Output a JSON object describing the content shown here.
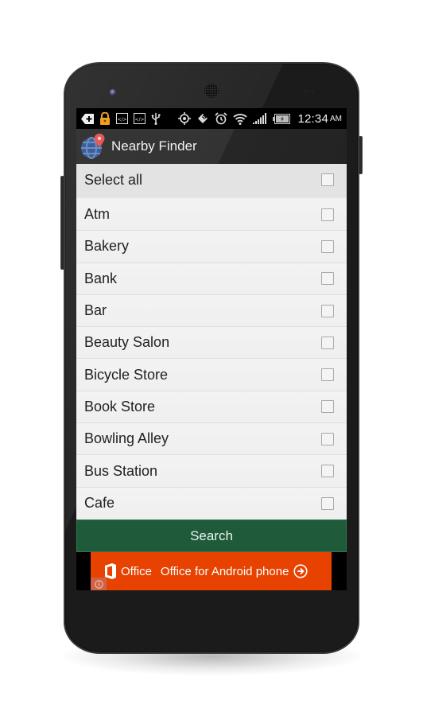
{
  "status_bar": {
    "icons": [
      "add-notification-icon",
      "lock-icon",
      "code-icon",
      "code-icon",
      "usb-icon",
      "gps-icon",
      "nfc-icon",
      "alarm-icon",
      "wifi-icon",
      "signal-icon",
      "battery-charging-icon"
    ],
    "time": "12:34",
    "ampm": "AM"
  },
  "action_bar": {
    "app_icon": "globe-pin-icon",
    "title": "Nearby Finder"
  },
  "select_all": {
    "label": "Select all",
    "checked": false
  },
  "categories": [
    {
      "label": "Atm",
      "checked": false
    },
    {
      "label": "Bakery",
      "checked": false
    },
    {
      "label": "Bank",
      "checked": false
    },
    {
      "label": "Bar",
      "checked": false
    },
    {
      "label": "Beauty Salon",
      "checked": false
    },
    {
      "label": "Bicycle Store",
      "checked": false
    },
    {
      "label": "Book Store",
      "checked": false
    },
    {
      "label": "Bowling Alley",
      "checked": false
    },
    {
      "label": "Bus Station",
      "checked": false
    },
    {
      "label": "Cafe",
      "checked": false
    }
  ],
  "search_button": {
    "label": "Search",
    "color": "#1f5b3b"
  },
  "ad": {
    "brand": "Office",
    "text": "Office for Android phone",
    "color": "#e84200",
    "info_icon": "info-icon",
    "arrow_icon": "arrow-circle-right-icon"
  }
}
